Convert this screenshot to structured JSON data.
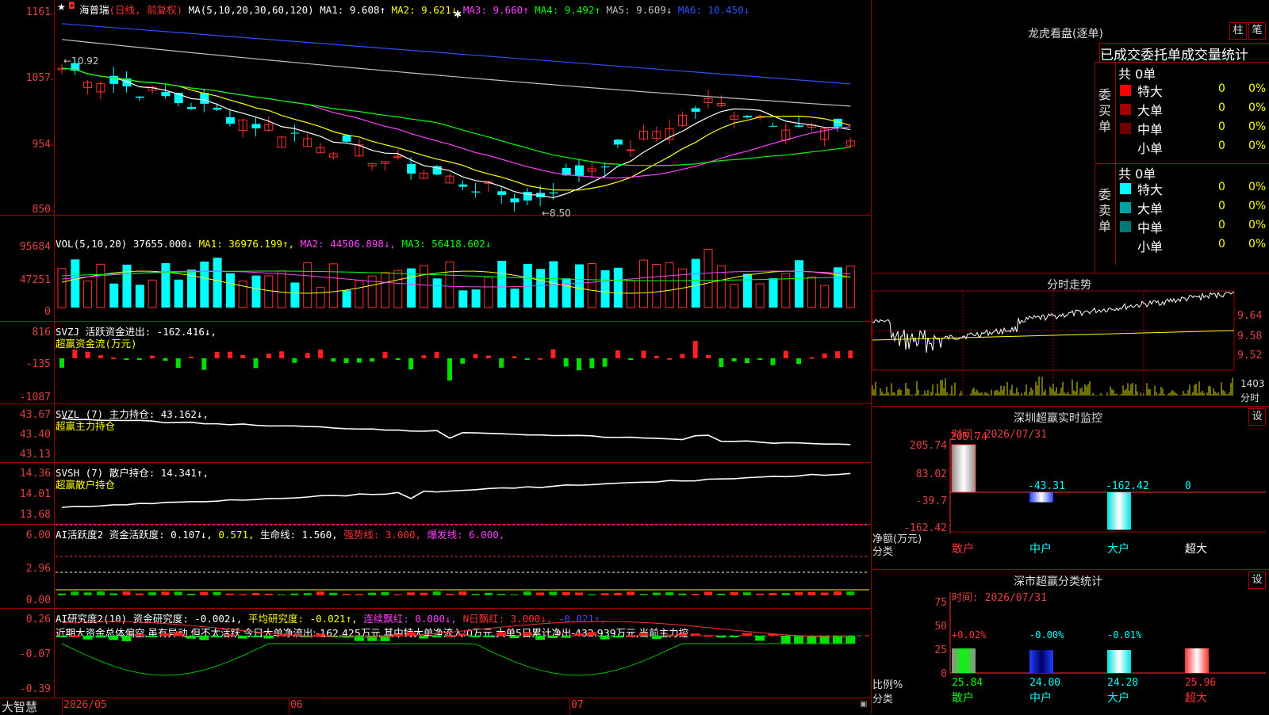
{
  "main": {
    "stock": "海普瑞",
    "period": "(日线, 前复权)",
    "ma_params": "MA(5,10,20,30,60,120)",
    "ma": [
      {
        "label": "MA1:",
        "value": "9.608↑",
        "color": "#ffffff"
      },
      {
        "label": "MA2:",
        "value": "9.621↓",
        "color": "#ffff00"
      },
      {
        "label": "MA3:",
        "value": "9.660↑",
        "color": "#ff40ff"
      },
      {
        "label": "MA4:",
        "value": "9.492↑",
        "color": "#00ff00"
      },
      {
        "label": "MA5:",
        "value": "9.609↓",
        "color": "#c0c0c0"
      },
      {
        "label": "MA6:",
        "value": "10.450↓",
        "color": "#3050ff"
      }
    ],
    "y_labels": [
      "1161",
      "1057",
      "954",
      "850"
    ],
    "high_note": "←10.92",
    "low_note": "←8.50"
  },
  "vol": {
    "params": "VOL(5,10,20)",
    "value": "37655.000↓",
    "ma1": "MA1: 36976.199↑,",
    "ma2": "MA2: 44506.898↓,",
    "ma3": "MA3: 56418.602↓",
    "y_labels": [
      "95684",
      "47251",
      "0"
    ]
  },
  "svzj": {
    "title": "SVZJ  活跃资金进出: -162.416↓,",
    "sub": "超赢资金流(万元)",
    "y_labels": [
      "816",
      "-135",
      "-1087"
    ]
  },
  "svzl": {
    "title": "SVZL (7) 主力持仓: 43.162↓,",
    "sub": "超赢主力持仓",
    "y_labels": [
      "43.67",
      "43.40",
      "43.13"
    ]
  },
  "svsh": {
    "title": "SVSH (7) 散户持仓: 14.341↑,",
    "sub": "超赢散户持仓",
    "y_labels": [
      "14.36",
      "14.01",
      "13.68"
    ]
  },
  "ai1": {
    "t1": "AI活跃度2 资金活跃度: 0.107↓,",
    "t2": "0.571,",
    "t3": "生命线: 1.560,",
    "t4": "强势线: 3.000,",
    "t5": "爆发线: 6.000,",
    "y_labels": [
      "6.00",
      "2.96",
      "0.00"
    ]
  },
  "ai2": {
    "t1": "AI研究度2(10) 资金研究度: -0.002↓,",
    "t2": "平均研究度: -0.021↑,",
    "t3": "连续飘红: 0.000↓,",
    "t4": "N日飘红: 3.000↓,",
    "t5": "-0.021↑,",
    "comment": "近期大资金总体偏空,虽有异动,但不太活跃,今日大单净流出:-162.425万元,其中特大单净流入:0万元,大单5日累计净出-432.939万元,当前主力控",
    "y_labels": [
      "0.26",
      "-0.07",
      "-0.39"
    ]
  },
  "footer": {
    "brand": "大智慧",
    "dates": [
      "2026/05",
      "06",
      "07"
    ]
  },
  "lhb": {
    "title": "龙虎看盘(逐单)",
    "btn1": "柱",
    "btn2": "笔",
    "tabs": "已成交委托单成交量统计",
    "buy_label": "委买单",
    "sell_label": "委卖单",
    "buy_total": "共 0单",
    "sell_total": "共 0单",
    "buy_rows": [
      {
        "name": "特大",
        "count": "0",
        "pct": "0%",
        "color": "#ff0000"
      },
      {
        "name": "大单",
        "count": "0",
        "pct": "0%",
        "color": "#a00000"
      },
      {
        "name": "中单",
        "count": "0",
        "pct": "0%",
        "color": "#700000"
      },
      {
        "name": "小单",
        "count": "0",
        "pct": "0%",
        "color": ""
      }
    ],
    "sell_rows": [
      {
        "name": "特大",
        "count": "0",
        "pct": "0%",
        "color": "#00ffff"
      },
      {
        "name": "大单",
        "count": "0",
        "pct": "0%",
        "color": "#00a0a0"
      },
      {
        "name": "中单",
        "count": "0",
        "pct": "0%",
        "color": "#007878"
      },
      {
        "name": "小单",
        "count": "0",
        "pct": "0%",
        "color": ""
      }
    ]
  },
  "fenshi": {
    "title": "分时走势",
    "y_labels": [
      "9.64",
      "9.58",
      "9.52"
    ],
    "vol_label": "1403",
    "vol_unit": "分时"
  },
  "monitor": {
    "title": "深圳超赢实时监控",
    "btn": "设",
    "time": "时间: 2026/07/31",
    "y_labels": [
      "205.74",
      "83.02",
      "-39.7",
      "-162.42"
    ],
    "values": [
      "205.74",
      "-43.31",
      "-162.42",
      "0"
    ],
    "net_label": "净额(万元)",
    "cat_label": "分类",
    "categories": [
      "散户",
      "中户",
      "大户",
      "超大"
    ]
  },
  "classify": {
    "title": "深市超赢分类统计",
    "btn": "设",
    "time": "时间: 2026/07/31",
    "y_labels": [
      "75",
      "50",
      "25",
      "0"
    ],
    "pct_labels": [
      "+0.02%",
      "-0.00%",
      "-0.01%"
    ],
    "values": [
      "25.84",
      "24.00",
      "24.20",
      "25.96"
    ],
    "ratio_label": "比例%",
    "cat_label": "分类",
    "categories": [
      "散户",
      "中户",
      "大户",
      "超大"
    ]
  }
}
